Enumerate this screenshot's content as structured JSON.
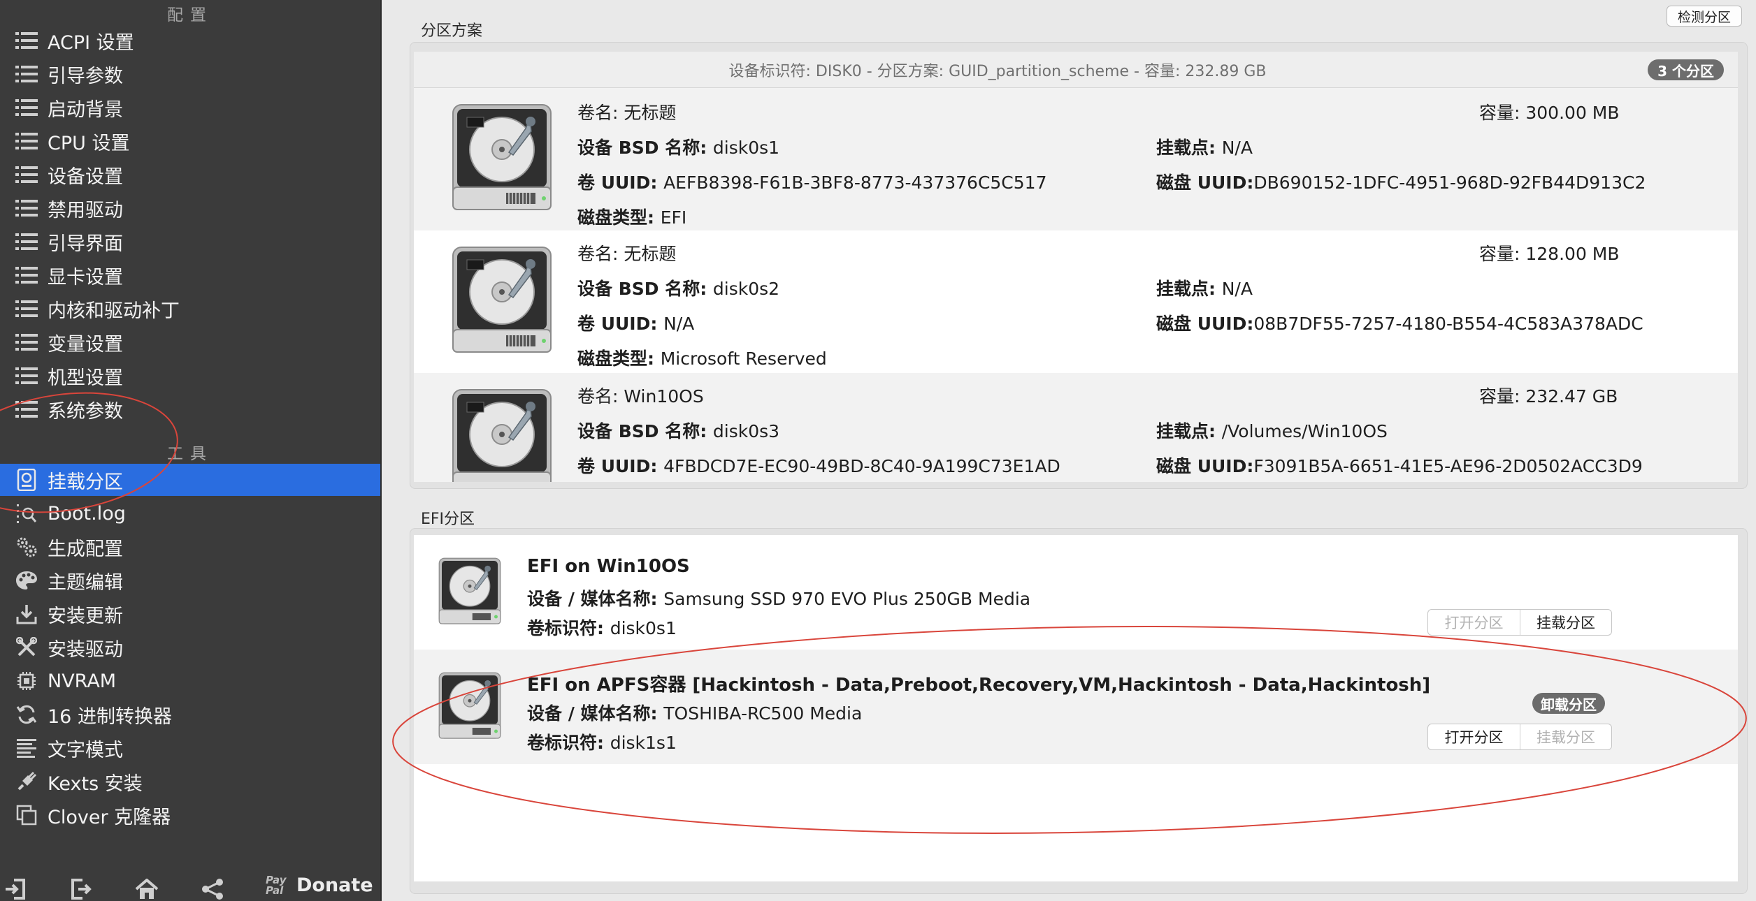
{
  "sidebar": {
    "config_header": "配置",
    "config_items": [
      {
        "label": "ACPI 设置",
        "icon": "list-icon"
      },
      {
        "label": "引导参数",
        "icon": "list-icon"
      },
      {
        "label": "启动背景",
        "icon": "list-icon"
      },
      {
        "label": "CPU 设置",
        "icon": "list-icon"
      },
      {
        "label": "设备设置",
        "icon": "list-icon"
      },
      {
        "label": "禁用驱动",
        "icon": "list-icon"
      },
      {
        "label": "引导界面",
        "icon": "list-icon"
      },
      {
        "label": "显卡设置",
        "icon": "list-icon"
      },
      {
        "label": "内核和驱动补丁",
        "icon": "list-icon"
      },
      {
        "label": "变量设置",
        "icon": "list-icon"
      },
      {
        "label": "机型设置",
        "icon": "list-icon"
      },
      {
        "label": "系统参数",
        "icon": "list-icon"
      }
    ],
    "tools_header": "工具",
    "tool_items": [
      {
        "label": "挂载分区",
        "icon": "mount-disk-icon",
        "active": true
      },
      {
        "label": "Boot.log",
        "icon": "log-search-icon"
      },
      {
        "label": "生成配置",
        "icon": "gears-icon"
      },
      {
        "label": "主题编辑",
        "icon": "palette-icon"
      },
      {
        "label": "安装更新",
        "icon": "download-icon"
      },
      {
        "label": "安装驱动",
        "icon": "tools-icon"
      },
      {
        "label": "NVRAM",
        "icon": "chip-icon"
      },
      {
        "label": "16 进制转换器",
        "icon": "refresh-icon"
      },
      {
        "label": "文字模式",
        "icon": "text-lines-icon"
      },
      {
        "label": "Kexts 安装",
        "icon": "plugin-icon"
      },
      {
        "label": "Clover 克隆器",
        "icon": "clone-icon"
      }
    ],
    "bottom": {
      "icons": [
        "import-icon",
        "export-icon",
        "home-icon",
        "share-icon"
      ],
      "paypal_mark": "Pay\nPal",
      "donate_label": "Donate"
    }
  },
  "toolbar": {
    "detect_label": "检测分区"
  },
  "partition_scheme": {
    "title": "分区方案",
    "info": "设备标识符: DISK0 - 分区方案: GUID_partition_scheme - 容量: 232.89 GB",
    "badge": "3 个分区",
    "labels": {
      "volume_name": "卷名: ",
      "capacity": "容量: ",
      "bsd_name": "设备 BSD 名称: ",
      "mount_point": "挂载点: ",
      "volume_uuid": "卷 UUID: ",
      "disk_uuid": "磁盘 UUID:",
      "disk_type": "磁盘类型: "
    },
    "partitions": [
      {
        "volume_name": "无标题",
        "capacity": "300.00 MB",
        "bsd_name": "disk0s1",
        "mount_point": "N/A",
        "volume_uuid": "AEFB8398-F61B-3BF8-8773-437376C5C517",
        "disk_uuid": "DB690152-1DFC-4951-968D-92FB44D913C2",
        "disk_type": "EFI"
      },
      {
        "volume_name": "无标题",
        "capacity": "128.00 MB",
        "bsd_name": "disk0s2",
        "mount_point": "N/A",
        "volume_uuid": "N/A",
        "disk_uuid": "08B7DF55-7257-4180-B554-4C583A378ADC",
        "disk_type": "Microsoft Reserved"
      },
      {
        "volume_name": "Win10OS",
        "capacity": "232.47 GB",
        "bsd_name": "disk0s3",
        "mount_point": "/Volumes/Win10OS",
        "volume_uuid": "4FBDCD7E-EC90-49BD-8C40-9A199C73E1AD",
        "disk_uuid": "F3091B5A-6651-41E5-AE96-2D0502ACC3D9",
        "disk_type": ""
      }
    ]
  },
  "efi": {
    "title": "EFI分区",
    "labels": {
      "media_name": "设备 / 媒体名称: ",
      "volume_id": "卷标识符: "
    },
    "open_label": "打开分区",
    "mount_label": "挂载分区",
    "unmount_badge": "卸载分区",
    "entries": [
      {
        "title": "EFI on Win10OS",
        "media_name": "Samsung SSD 970 EVO Plus 250GB Media",
        "volume_id": "disk0s1",
        "mounted": false
      },
      {
        "title": "EFI on APFS容器 [Hackintosh - Data,Preboot,Recovery,VM,Hackintosh - Data,Hackintosh]",
        "media_name": "TOSHIBA-RC500 Media",
        "volume_id": "disk1s1",
        "mounted": true
      }
    ]
  },
  "colors": {
    "sidebar_bg": "#3b3b3b",
    "active_item": "#2a6de0",
    "annotation": "#d9453b"
  }
}
